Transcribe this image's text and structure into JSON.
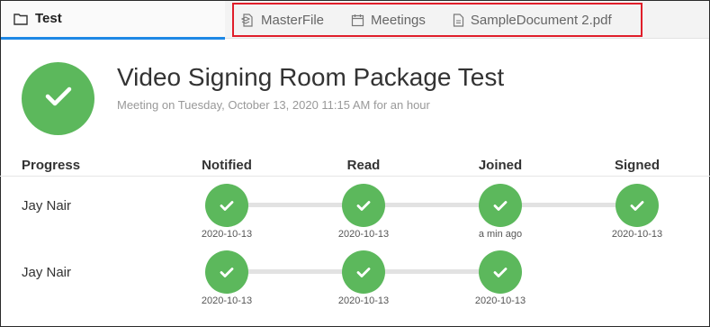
{
  "tabs": {
    "active": {
      "label": "Test",
      "icon": "folder-icon"
    },
    "items": [
      {
        "label": "MasterFile",
        "icon": "masterfile-icon"
      },
      {
        "label": "Meetings",
        "icon": "calendar-icon"
      },
      {
        "label": "SampleDocument 2.pdf",
        "icon": "document-icon"
      }
    ],
    "highlight_color": "#e01e2a",
    "active_underline_color": "#1e88e5"
  },
  "meeting": {
    "title": "Video Signing Room Package Test",
    "subtitle": "Meeting on Tuesday, October 13, 2020 11:15 AM for an hour",
    "status_color": "#5cb85c"
  },
  "progress": {
    "columns": [
      "Progress",
      "Notified",
      "Read",
      "Joined",
      "Signed"
    ],
    "rows": [
      {
        "name": "Jay Nair",
        "steps": [
          "2020-10-13",
          "2020-10-13",
          "a min ago",
          "2020-10-13"
        ]
      },
      {
        "name": "Jay Nair",
        "steps": [
          "2020-10-13",
          "2020-10-13",
          "2020-10-13"
        ]
      }
    ]
  }
}
